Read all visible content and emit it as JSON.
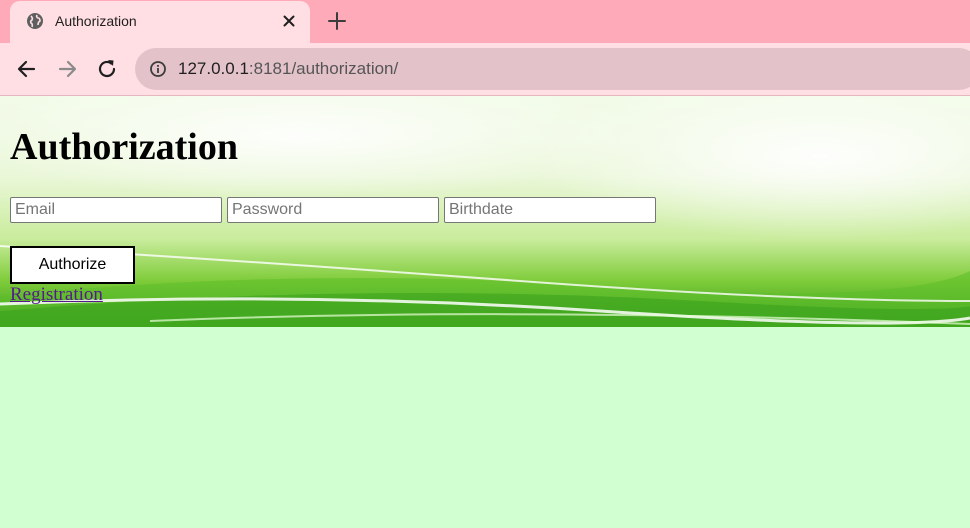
{
  "browser": {
    "tab": {
      "title": "Authorization",
      "favicon": "globe-icon"
    },
    "new_tab_icon": "plus-icon",
    "nav": {
      "back_icon": "arrow-left-icon",
      "forward_icon": "arrow-right-icon",
      "reload_icon": "reload-icon",
      "site_info_icon": "info-icon"
    },
    "url": {
      "host": "127.0.0.1",
      "rest": ":8181/authorization/"
    }
  },
  "page": {
    "title": "Authorization",
    "form": {
      "email_placeholder": "Email",
      "password_placeholder": "Password",
      "birthdate_placeholder": "Birthdate",
      "submit_label": "Authorize"
    },
    "registration_link": "Registration"
  },
  "colors": {
    "tabstrip": "#ffaab8",
    "toolbar": "#ffdfe4",
    "omnibox": "#e3c3c9",
    "page_background": "#d1ffd1",
    "link": "#551a8b"
  }
}
